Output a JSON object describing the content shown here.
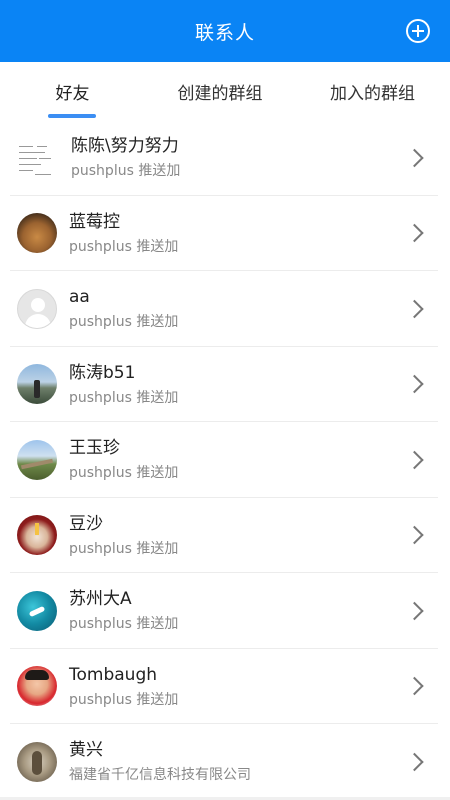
{
  "header": {
    "title": "联系人",
    "add_icon": "plus-circle-icon"
  },
  "tabs": [
    {
      "label": "好友",
      "active": true
    },
    {
      "label": "创建的群组",
      "active": false
    },
    {
      "label": "加入的群组",
      "active": false
    }
  ],
  "contacts": [
    {
      "name": "陈陈\\努力努力",
      "subtitle": "pushplus 推送加",
      "avatar": "document-thumbnail"
    },
    {
      "name": "蓝莓控",
      "subtitle": "pushplus 推送加",
      "avatar": "dog-photo"
    },
    {
      "name": "aa",
      "subtitle": "pushplus 推送加",
      "avatar": "default-user-icon"
    },
    {
      "name": "陈涛b51",
      "subtitle": "pushplus 推送加",
      "avatar": "lake-photo"
    },
    {
      "name": "王玉珍",
      "subtitle": "pushplus 推送加",
      "avatar": "great-wall-photo"
    },
    {
      "name": "豆沙",
      "subtitle": "pushplus 推送加",
      "avatar": "cake-photo"
    },
    {
      "name": "苏州大A",
      "subtitle": "pushplus 推送加",
      "avatar": "sea-boat-photo"
    },
    {
      "name": "Tombaugh",
      "subtitle": "pushplus 推送加",
      "avatar": "child-photo"
    },
    {
      "name": "黄兴",
      "subtitle": "福建省千亿信息科技有限公司",
      "avatar": "statue-photo"
    }
  ],
  "colors": {
    "header_bg": "#0a84f5",
    "tab_indicator": "#3b8ef3",
    "subtitle": "#888888"
  }
}
